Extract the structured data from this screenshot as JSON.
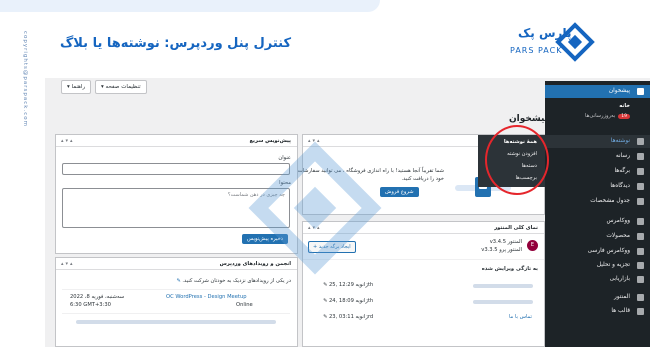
{
  "banner": {
    "title": "کنترل پنل وردپرس: نوشته‌ها یا بلاگ",
    "logo_fa": "پارس پک",
    "logo_en": "PARS PACK",
    "watermark": "copyrights@parspack.com"
  },
  "topbar": {
    "screen_options": "تنظیمات صفحه",
    "help": "راهنما"
  },
  "page_title": "پیشخوان",
  "sidebar": {
    "dashboard": "پیشخوان",
    "home": "خانه",
    "updates": "به‌روزرسانی‌ها",
    "updates_count": "19",
    "posts": "نوشته‌ها",
    "media": "رسانه",
    "pages": "برگه‌ها",
    "comments": "دیدگاه‌ها",
    "custom_fields": "جدول مشخصات",
    "woocommerce": "ووکامرس",
    "products": "محصولات",
    "woo_fa": "ووکامرس فارسی",
    "analytics": "تجزیه و تحلیل",
    "marketing": "بازاریابی",
    "elementor": "المنتور",
    "templates": "قالب ها"
  },
  "flyout": {
    "all_posts": "همهٔ نوشته‌ها",
    "add_new": "افزودن نوشته",
    "categories": "دسته‌ها",
    "tags": "برچسب‌ها"
  },
  "quick_draft": {
    "title": "پیش‌نویس سریع",
    "title_label": "عنوان",
    "content_label": "محتوا",
    "content_placeholder": "چه چیزی در ذهن شماست؟",
    "save_button": "ذخیره پیش‌نویس"
  },
  "wp_events": {
    "title": "انجمن و رویدادهای وردپرس",
    "intro": "در یکی از رویدادهای نزدیک به خودتان شرکت کنید.",
    "event_name": "OC WordPress - Design Meetup",
    "event_type": "Online",
    "event_date": "سه‌شنبه، فوریه 8، 2022",
    "event_time": "6:30 GMT+3:30"
  },
  "woo_setup": {
    "text_1": "شما تقریباً آنجا هستید! با راه اندازی فروشگاه ، می توانید سفارشات",
    "text_2": "خود را دریافت کنید.",
    "button": "شروع فروش"
  },
  "elementor_overview": {
    "title": "نمای کلی المنتور",
    "version_1": "المنتور v3.4.5",
    "version_2": "المنتور پرو v3.3.5",
    "create_page": "ایجاد برگه جدید",
    "recent_title": "به تازگی ویرایش شده",
    "row_1_date": "ژانویه 12:29 ,25th",
    "row_2_date": "ژانویه 18:09 ,24th",
    "row_3_date": "ژانویه 03:11 ,23rd",
    "row_3_link": "تماس با ما"
  }
}
